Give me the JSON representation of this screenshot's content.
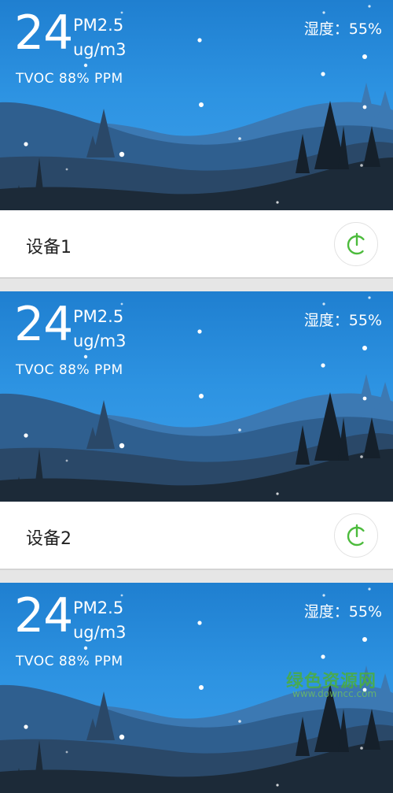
{
  "cards": [
    {
      "pm_value": "24",
      "pm_label": "PM2.5",
      "unit": "ug/m3",
      "tvoc": "TVOC 88% PPM",
      "humidity": "湿度：55%",
      "device_name": "设备1",
      "power_icon": "power-icon",
      "power_state": "on"
    },
    {
      "pm_value": "24",
      "pm_label": "PM2.5",
      "unit": "ug/m3",
      "tvoc": "TVOC 88% PPM",
      "humidity": "湿度：55%",
      "device_name": "设备2",
      "power_icon": "power-icon",
      "power_state": "on"
    },
    {
      "pm_value": "24",
      "pm_label": "PM2.5",
      "unit": "ug/m3",
      "tvoc": "TVOC 88% PPM",
      "humidity": "湿度：55%"
    }
  ],
  "colors": {
    "sky_top": "#1f7fd0",
    "sky_bottom": "#3da0ea",
    "power_green": "#4cbb3c",
    "row_bg": "#ffffff"
  },
  "watermark": {
    "text": "绿色资源网",
    "url": "www.downcc.com"
  }
}
